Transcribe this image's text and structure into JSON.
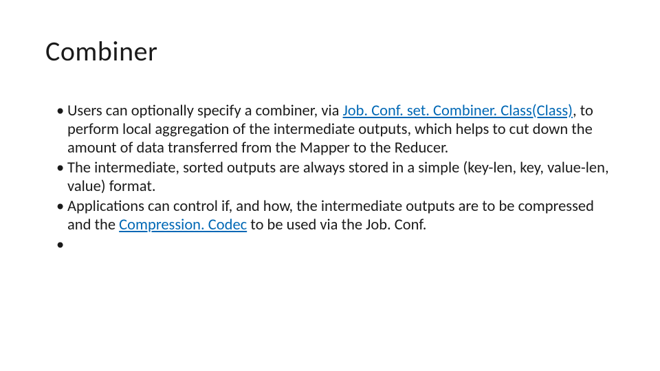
{
  "title": "Combiner",
  "bullets": {
    "b1a": "Users can optionally specify a combiner, via ",
    "b1link": "Job. Conf. set. Combiner. Class(Class)",
    "b1b": ", to perform local aggregation of the intermediate outputs, which helps to cut down the amount of data transferred from the Mapper to the Reducer.",
    "b2": "The intermediate, sorted outputs are always stored in a simple (key-len, key, value-len, value) format.",
    "b3a": "Applications can control if, and how, the intermediate outputs are to be compressed and the ",
    "b3link": "Compression. Codec",
    "b3b": " to be used via the Job. Conf.",
    "b4": ""
  }
}
